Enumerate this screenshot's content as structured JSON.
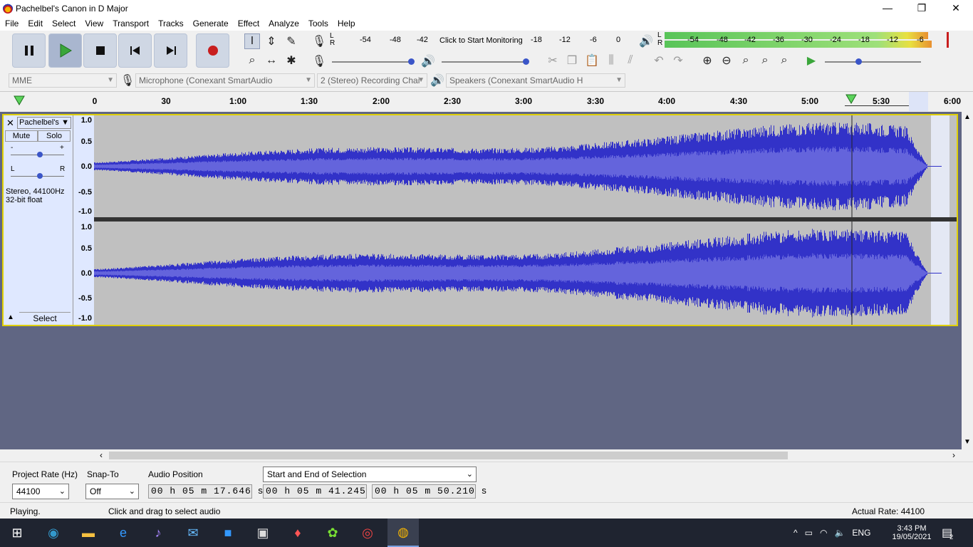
{
  "window": {
    "title": "Pachelbel's Canon in D Major",
    "min": "—",
    "max": "❐",
    "close": "✕"
  },
  "menu": [
    "File",
    "Edit",
    "Select",
    "View",
    "Transport",
    "Tracks",
    "Generate",
    "Effect",
    "Analyze",
    "Tools",
    "Help"
  ],
  "recMeter": {
    "l": "L",
    "r": "R",
    "scale": [
      "-54",
      "-48",
      "-42",
      "-18",
      "-12",
      "-6",
      "0"
    ],
    "prompt": "Click to Start Monitoring"
  },
  "playMeter": {
    "l": "L",
    "r": "R",
    "scale": [
      "-54",
      "-48",
      "-42",
      "-36",
      "-30",
      "-24",
      "-18",
      "-12",
      "-6"
    ]
  },
  "device": {
    "host": "MME",
    "input": "Microphone (Conexant SmartAudio",
    "channels": "2 (Stereo) Recording Chai",
    "output": "Speakers (Conexant SmartAudio H"
  },
  "ruler": [
    "0",
    "30",
    "1:00",
    "1:30",
    "2:00",
    "2:30",
    "3:00",
    "3:30",
    "4:00",
    "4:30",
    "5:00",
    "5:30",
    "6:00"
  ],
  "track": {
    "name": "Pachelbel's",
    "mute": "Mute",
    "solo": "Solo",
    "gainMinus": "-",
    "gainPlus": "+",
    "panL": "L",
    "panR": "R",
    "info1": "Stereo, 44100Hz",
    "info2": "32-bit float",
    "select": "Select",
    "scale": [
      "1.0",
      "0.5",
      "0.0",
      "-0.5",
      "-1.0"
    ]
  },
  "selection": {
    "rateLabel": "Project Rate (Hz)",
    "rate": "44100",
    "snapLabel": "Snap-To",
    "snap": "Off",
    "posLabel": "Audio Position",
    "mode": "Start and End of Selection",
    "pos": "00 h 05 m 17.646 s",
    "start": "00 h 05 m 41.245 s",
    "end": "00 h 05 m 50.210 s"
  },
  "status": {
    "state": "Playing.",
    "hint": "Click and drag to select audio",
    "rate": "Actual Rate: 44100"
  },
  "taskbar": {
    "lang": "ENG",
    "time": "3:43 PM",
    "date": "19/05/2021",
    "notif": "2"
  },
  "colors": {
    "waveform": "#3232c8",
    "waveRms": "#6464dc",
    "trackBg": "#c0c0c0",
    "selectedTrackBorder": "#e0d000",
    "playButton": "#3aa63a",
    "recordButton": "#c81e1e"
  }
}
